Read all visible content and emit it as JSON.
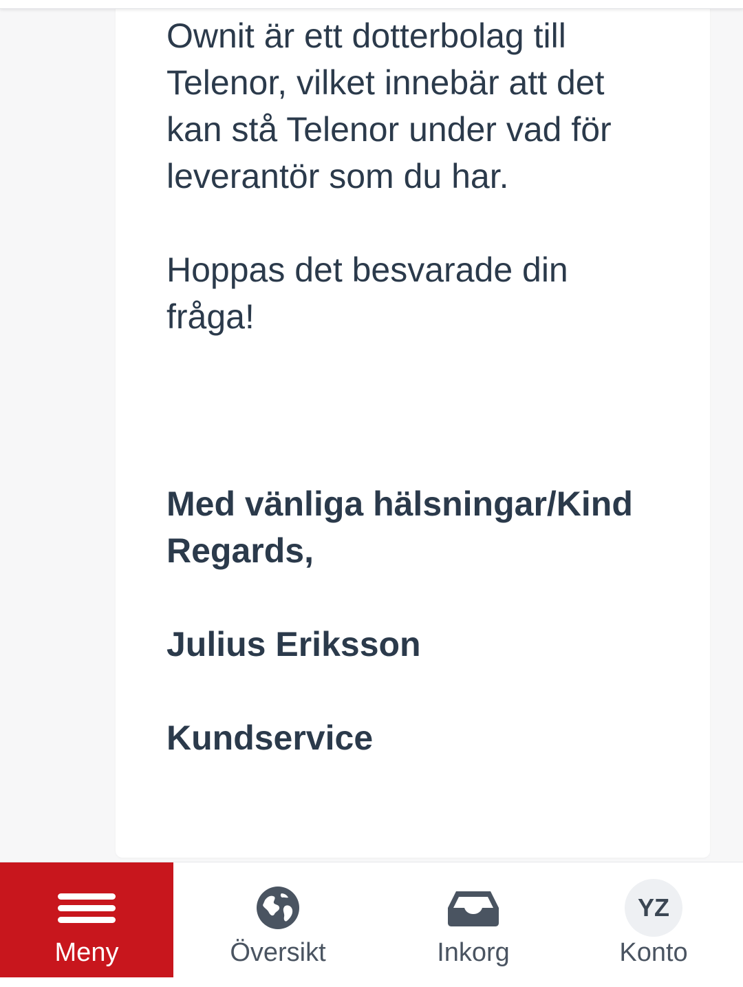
{
  "message": {
    "paragraph_1": "Ownit är ett dotterbolag till\nTelenor, vilket innebär att det\nkan stå Telenor under vad för\nleverantör som du har.",
    "paragraph_2": "Hoppas det besvarade din\nfråga!",
    "signature_greeting": "Med vänliga hälsningar/Kind Regards,",
    "signature_name": "Julius Eriksson",
    "signature_department": "Kundservice"
  },
  "bottom_nav": {
    "meny": {
      "label": "Meny",
      "icon": "hamburger-menu-icon"
    },
    "oversikt": {
      "label": "Översikt",
      "icon": "globe-icon"
    },
    "inkorg": {
      "label": "Inkorg",
      "icon": "inbox-tray-icon"
    },
    "konto": {
      "label": "Konto",
      "avatar_initials": "YZ"
    }
  },
  "colors": {
    "accent_red": "#c8161d",
    "text": "#2b3a4b",
    "nav_icon": "#4a5461"
  }
}
